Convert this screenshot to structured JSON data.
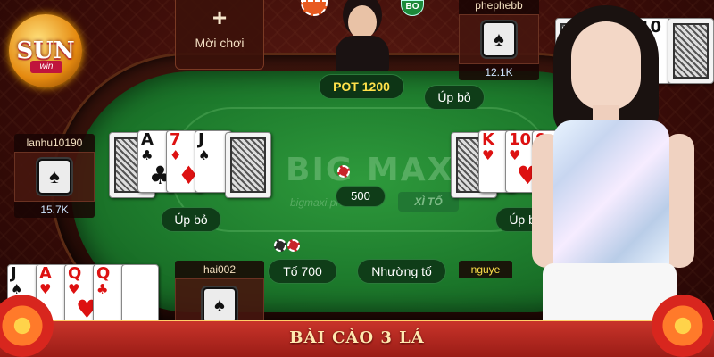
{
  "invite": {
    "plus": "+",
    "label": "Mời chơi"
  },
  "dealer_badge": "BO",
  "pot": "POT 1200",
  "center_bet": "500",
  "watermark": {
    "brand": "BIG MAX",
    "url": "bigmaxi.pro",
    "badge": "XÌ TỐ"
  },
  "logo": {
    "brand": "SUN",
    "sub": "win"
  },
  "players": {
    "top_right": {
      "name": "phephebb",
      "chips": "12.1K"
    },
    "left": {
      "name": "lanhu10190",
      "chips": "15.7K",
      "action": "Úp bỏ"
    },
    "right": {
      "name": "",
      "chips": "",
      "action": "Úp bỏ"
    },
    "bottom_center": {
      "name": "hai002"
    },
    "bottom_right": {
      "name": "nguye"
    },
    "top_right_action": "Úp bỏ"
  },
  "actions": {
    "raise": "Tố 700",
    "check": "Nhường tố"
  },
  "cards": {
    "left": [
      {
        "rank": "A",
        "suit": "♣",
        "color": "black"
      },
      {
        "rank": "7",
        "suit": "♦",
        "color": "red"
      },
      {
        "rank": "J",
        "suit": "♠",
        "color": "black"
      }
    ],
    "right": [
      {
        "rank": "K",
        "suit": "♥",
        "color": "red"
      },
      {
        "rank": "10",
        "suit": "♥",
        "color": "red"
      },
      {
        "rank": "9",
        "suit": "♥",
        "color": "red"
      }
    ],
    "top_right": [
      {
        "rank": "10",
        "suit": "♠",
        "color": "black"
      }
    ],
    "bottom_left": [
      {
        "rank": "J",
        "suit": "♠",
        "color": "black"
      },
      {
        "rank": "A",
        "suit": "♥",
        "color": "red"
      },
      {
        "rank": "Q",
        "suit": "♥",
        "color": "red"
      },
      {
        "rank": "Q",
        "suit": "♣",
        "color": "black"
      }
    ]
  },
  "seat_icon": "♠",
  "banner": "BÀI CÀO 3 LÁ",
  "colors": {
    "felt": "#1d7a2c",
    "pot_text": "#ffe14a",
    "banner": "#c8342a"
  }
}
